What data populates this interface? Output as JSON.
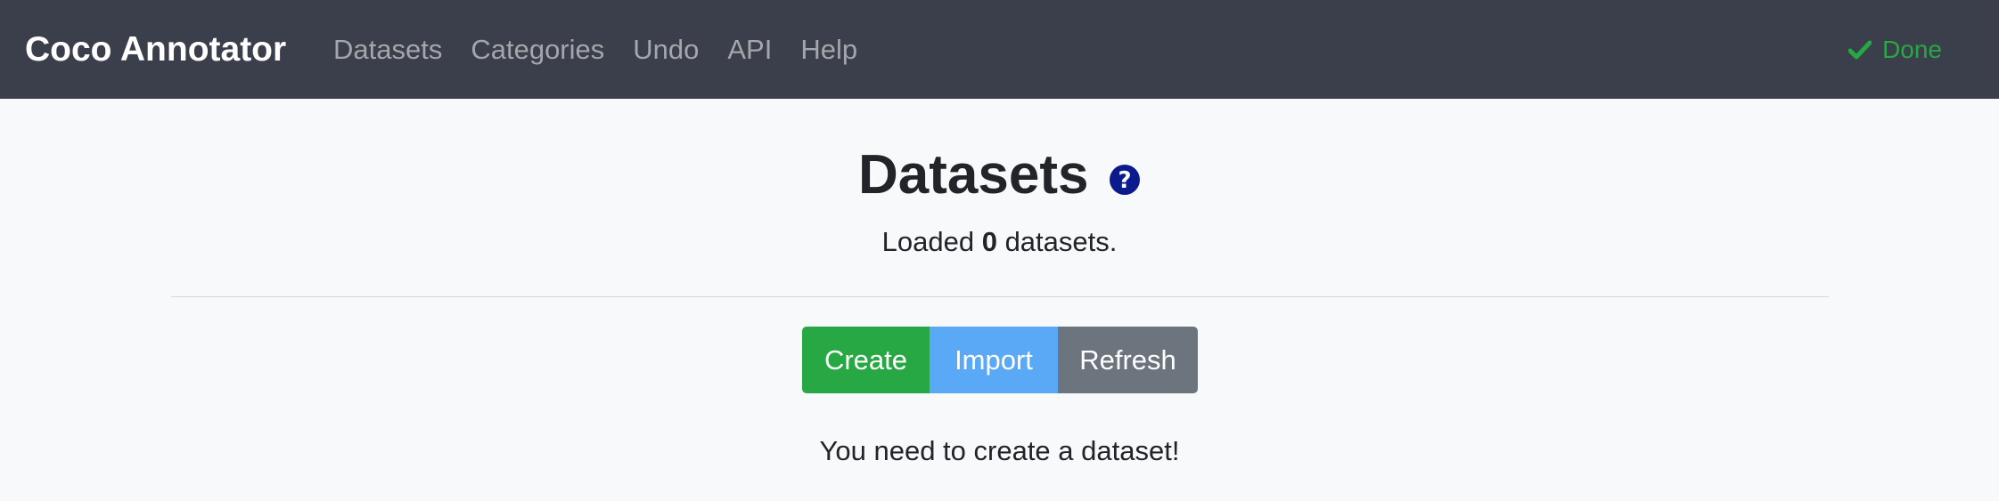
{
  "navbar": {
    "brand": "Coco Annotator",
    "links": [
      "Datasets",
      "Categories",
      "Undo",
      "API",
      "Help"
    ],
    "status": {
      "icon": "checkmark-icon",
      "label": "Done",
      "color": "#28a745"
    }
  },
  "page": {
    "title": "Datasets",
    "help_icon": "question-circle-icon",
    "loaded_prefix": "Loaded",
    "loaded_count": "0",
    "loaded_suffix": "datasets.",
    "buttons": {
      "create": "Create",
      "import": "Import",
      "refresh": "Refresh"
    },
    "empty_message": "You need to create a dataset!"
  },
  "colors": {
    "navbar_bg": "#3a3f4b",
    "create": "#28a745",
    "import": "#5aa9f7",
    "refresh": "#6c757d",
    "help_icon": "#0b1a8c"
  }
}
